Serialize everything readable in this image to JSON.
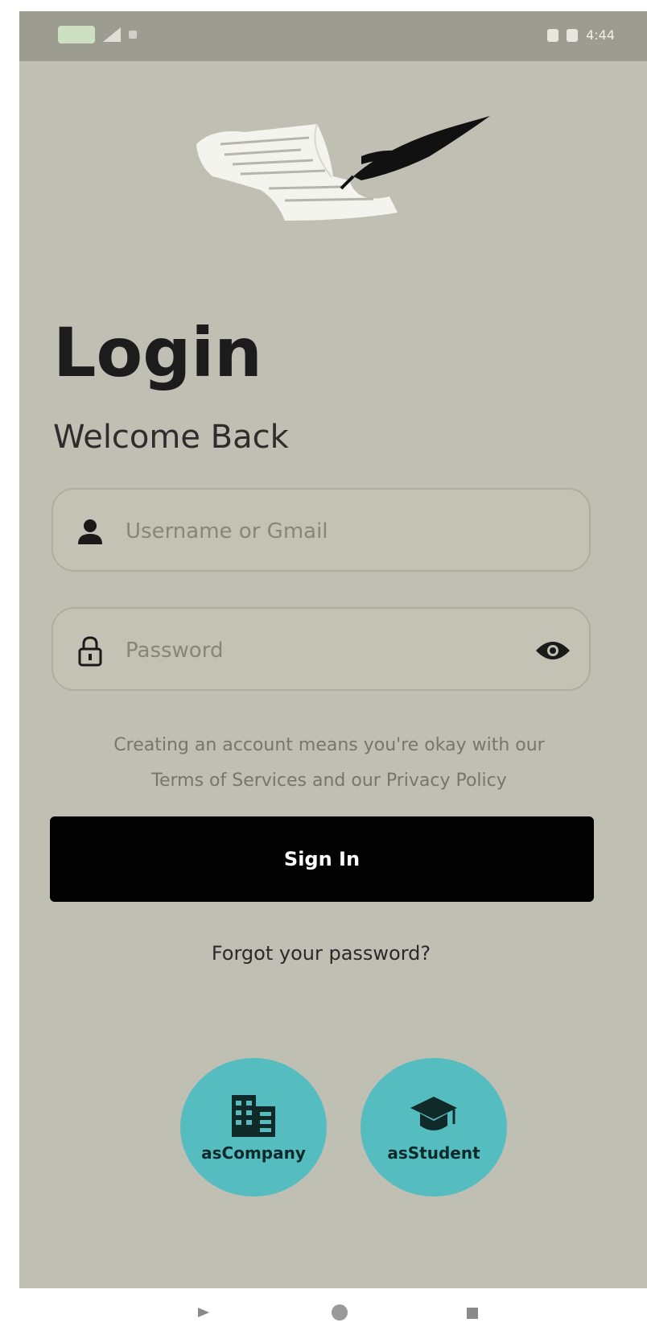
{
  "status_bar": {
    "time": "4:44"
  },
  "header": {
    "title": "Login",
    "subtitle": "Welcome Back"
  },
  "form": {
    "username_placeholder": "Username or Gmail",
    "password_placeholder": "Password",
    "terms_line1": "Creating an account means you're okay with our",
    "terms_line2": "Terms of Services and our Privacy Policy",
    "signin_label": "Sign In",
    "forgot_label": "Forgot your password?"
  },
  "roles": {
    "company_label": "asCompany",
    "student_label": "asStudent"
  },
  "colors": {
    "background": "#bfbfb3",
    "button": "#020202",
    "role_circle": "#55bcc0"
  },
  "icons": {
    "username": "person-icon",
    "password": "lock-icon",
    "toggle": "eye-icon",
    "company": "building-icon",
    "student": "graduation-cap-icon"
  }
}
